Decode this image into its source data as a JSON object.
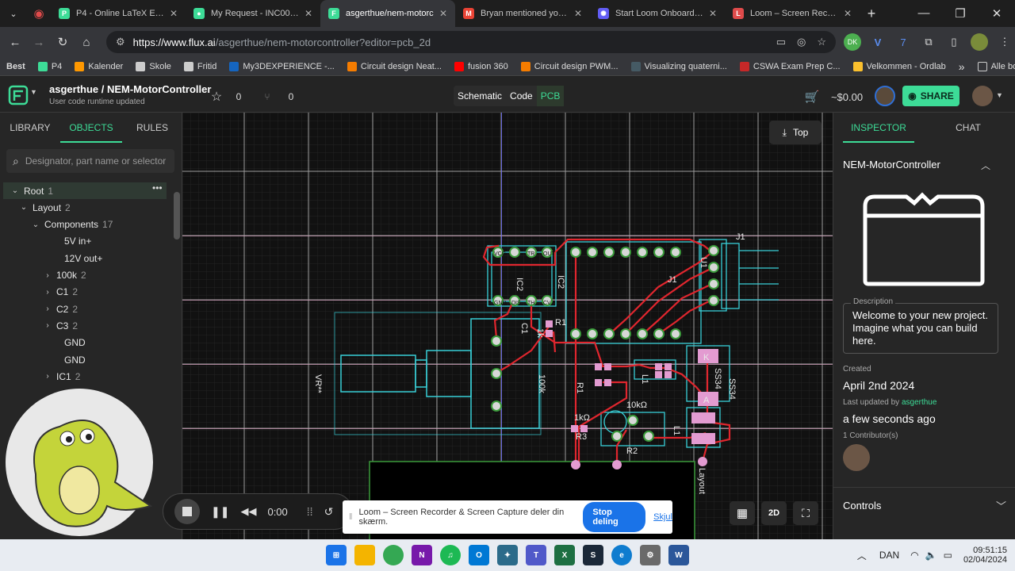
{
  "browser": {
    "tabs": [
      {
        "title": "P4 - Online LaTeX Editor O",
        "color": "#3ddc97",
        "glyph": "P",
        "active": false
      },
      {
        "title": "My Request - INC001161",
        "color": "#3ddc97",
        "glyph": "●",
        "active": false
      },
      {
        "title": "asgerthue/nem-motorc",
        "color": "#3ddc97",
        "glyph": "F",
        "active": true
      },
      {
        "title": "Bryan mentioned you - a",
        "color": "#ea4335",
        "glyph": "M",
        "active": false
      },
      {
        "title": "Start Loom Onboarding |",
        "color": "#625df5",
        "glyph": "✺",
        "active": false
      },
      {
        "title": "Loom – Screen Recorder",
        "color": "#e04b4b",
        "glyph": "L",
        "active": false
      }
    ],
    "new_tab": "+",
    "url_host": "https://www.flux.ai",
    "url_path": "/asgerthue/nem-motorcontroller?editor=pcb_2d",
    "bookmarks": [
      {
        "label": "Best",
        "color": "#f0c000"
      },
      {
        "label": "P4",
        "color": "#3ddc97"
      },
      {
        "label": "Kalender",
        "color": "#ff9800"
      },
      {
        "label": "Skole",
        "color": "#cccccc"
      },
      {
        "label": "Fritid",
        "color": "#cccccc"
      },
      {
        "label": "My3DEXPERIENCE -...",
        "color": "#1565c0"
      },
      {
        "label": "Circuit design Neat...",
        "color": "#f57c00"
      },
      {
        "label": "fusion 360",
        "color": "#ff0000"
      },
      {
        "label": "Circuit design PWM...",
        "color": "#f57c00"
      },
      {
        "label": "Visualizing quaterni...",
        "color": "#455a64"
      },
      {
        "label": "CSWA Exam Prep C...",
        "color": "#c62828"
      },
      {
        "label": "Velkommen - Ordlab",
        "color": "#fbc02d"
      }
    ],
    "bookmarks_more": "»",
    "all_bookmarks": "Alle bogmærker"
  },
  "app": {
    "project_title": "asgerthue / NEM-MotorController",
    "project_subtitle": "User code runtime updated",
    "stars": "0",
    "forks": "0",
    "modes": [
      "Schematic",
      "Code",
      "PCB"
    ],
    "active_mode": "PCB",
    "price": "~$0.00",
    "share": "SHARE"
  },
  "left": {
    "tabs": [
      "LIBRARY",
      "OBJECTS",
      "RULES"
    ],
    "active_tab": "OBJECTS",
    "search_placeholder": "Designator, part name or selector",
    "tree": [
      {
        "label": "Root",
        "count": "1",
        "arrow": "v",
        "indent": 0
      },
      {
        "label": "Layout",
        "count": "2",
        "arrow": "v",
        "indent": 1
      },
      {
        "label": "Components",
        "count": "17",
        "arrow": "v",
        "indent": 2
      },
      {
        "label": "5V in+",
        "count": "",
        "arrow": "",
        "indent": 3
      },
      {
        "label": "12V out+",
        "count": "",
        "arrow": "",
        "indent": 3
      },
      {
        "label": "100k",
        "count": "2",
        "arrow": ">",
        "indent": 3
      },
      {
        "label": "C1",
        "count": "2",
        "arrow": ">",
        "indent": 3
      },
      {
        "label": "C2",
        "count": "2",
        "arrow": ">",
        "indent": 3
      },
      {
        "label": "C3",
        "count": "2",
        "arrow": ">",
        "indent": 3
      },
      {
        "label": "GND",
        "count": "",
        "arrow": "",
        "indent": 3
      },
      {
        "label": "GND",
        "count": "",
        "arrow": "",
        "indent": 3
      },
      {
        "label": "IC1",
        "count": "2",
        "arrow": ">",
        "indent": 3
      }
    ]
  },
  "canvas": {
    "view_button": "Top",
    "mode_2d": "2D",
    "labels": [
      "J1",
      "IC2",
      "IC2",
      "J1",
      "R1",
      "1k",
      "C1",
      "VR**",
      "100k",
      "R1",
      "L1",
      "SS34",
      "SS34",
      "K",
      "A",
      "10kΩ",
      "1kΩ",
      "R3",
      "R2",
      "L1",
      "Layout",
      "U1"
    ],
    "pad_labels": [
      "TR",
      "DIS",
      "VCC",
      "GND",
      "CV",
      "TH",
      "OUT"
    ]
  },
  "right": {
    "tabs": [
      "INSPECTOR",
      "CHAT"
    ],
    "active_tab": "INSPECTOR",
    "project_name": "NEM-MotorController",
    "description_label": "Description",
    "description": "Welcome to your new project. Imagine what you can build here.",
    "created_label": "Created",
    "created": "April 2nd 2024",
    "updated_label": "Last updated by",
    "updated_by": "asgerthue",
    "updated_ago": "a few seconds ago",
    "contributors": "1 Contributor(s)",
    "controls": "Controls"
  },
  "loom": {
    "time": "0:00",
    "share_text": "Loom – Screen Recorder & Screen Capture deler din skærm.",
    "stop": "Stop deling",
    "hide": "Skjul"
  },
  "taskbar": {
    "lang": "DAN",
    "time": "09:51:15",
    "date": "02/04/2024"
  }
}
